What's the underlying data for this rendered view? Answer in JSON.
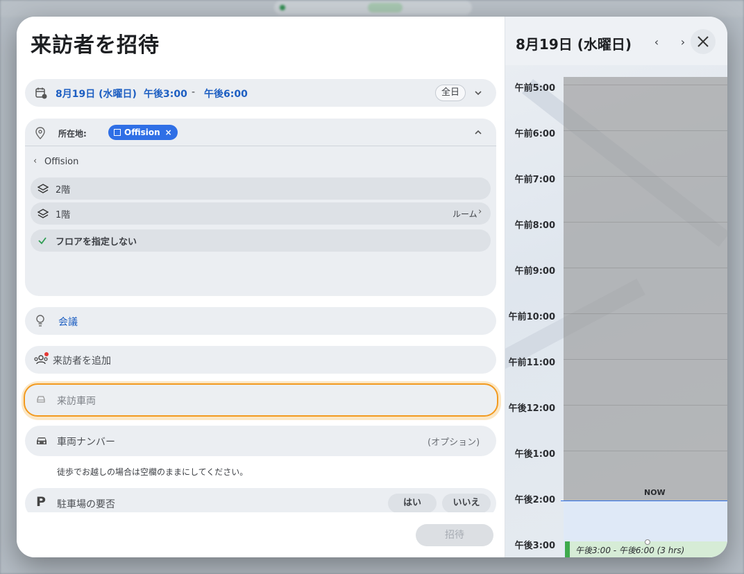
{
  "modal_title": "来訪者を招待",
  "datetime": {
    "date": "8月19日 (水曜日)",
    "start": "午後3:00",
    "separator": "-",
    "end": "午後6:00",
    "all_day": "全日"
  },
  "location": {
    "label": "所在地:",
    "tag": "Offision",
    "back_label": "Offision",
    "floors": [
      {
        "label": "2階",
        "room": ""
      },
      {
        "label": "1階",
        "room": "ルーム"
      },
      {
        "label": "フロアを指定しない",
        "room": ""
      }
    ]
  },
  "meeting": {
    "label": "会議"
  },
  "visitors": {
    "placeholder": "来訪者を追加"
  },
  "vehicle": {
    "placeholder": "来訪車両"
  },
  "plate": {
    "placeholder": "車両ナンバー",
    "optional": "(オプション)"
  },
  "hint": "徒歩でお越しの場合は空欄のままにしてください。",
  "parking": {
    "label": "駐車場の要否",
    "yes": "はい",
    "no": "いいえ"
  },
  "invite_button": "招待",
  "calendar": {
    "title": "8月19日 (水曜日)",
    "prev": "‹",
    "next": "›",
    "times": [
      "午前5:00",
      "午前6:00",
      "午前7:00",
      "午前8:00",
      "午前9:00",
      "午前10:00",
      "午前11:00",
      "午後12:00",
      "午後1:00",
      "午後2:00",
      "午後3:00"
    ],
    "now_label": "NOW",
    "event": "午後3:00 - 午後6:00 (3 hrs)"
  },
  "colors": {
    "accent": "#2f6fe6",
    "focus": "#f29a1f",
    "event": "#3faa4d"
  }
}
